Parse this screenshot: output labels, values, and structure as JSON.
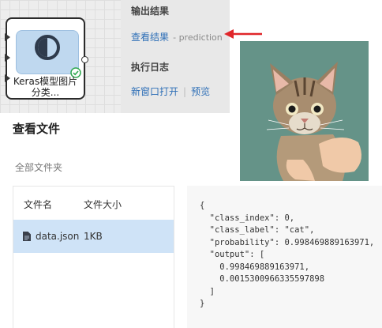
{
  "canvas": {
    "node_label_line1": "Keras模型图片",
    "node_label_line2": "分类..."
  },
  "output_panel": {
    "output_title": "输出结果",
    "view_result_link": "查看结果",
    "view_result_suffix": "- prediction",
    "log_title": "执行日志",
    "open_new_window": "新窗口打开",
    "preview": "预览"
  },
  "file_viewer": {
    "title": "查看文件",
    "breadcrumb": "全部文件夹",
    "columns": [
      "文件名",
      "文件大小"
    ],
    "files": [
      {
        "name": "data.json",
        "size": "1KB"
      }
    ]
  },
  "json_content": "{\n  \"class_index\": 0,\n  \"class_label\": \"cat\",\n  \"probability\": 0.998469889163971,\n  \"output\": [\n    0.998469889163971,\n    0.0015300966335597898\n  ]\n}",
  "colors": {
    "link": "#2e6fb7",
    "selected_row": "#cfe3f7",
    "annotation_arrow": "#e0262a",
    "status_ok": "#2fa84f"
  }
}
